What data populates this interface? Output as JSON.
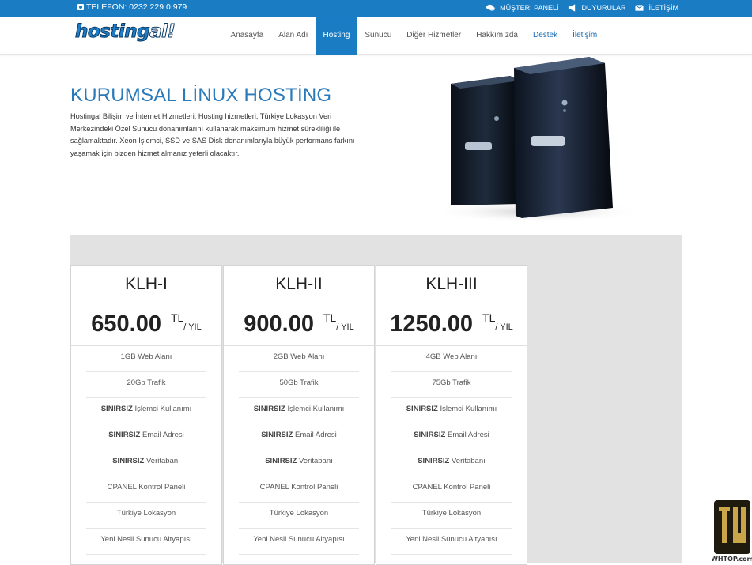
{
  "topbar": {
    "phone": "TELEFON: 0232 229 0 979",
    "links": [
      {
        "label": "MÜŞTERİ PANELİ",
        "icon": "chat-icon"
      },
      {
        "label": "DUYURULAR",
        "icon": "megaphone-icon"
      },
      {
        "label": "İLETİŞİM",
        "icon": "envelope-icon"
      }
    ]
  },
  "nav": {
    "logo_a": "hosting",
    "logo_b": "al!",
    "items": [
      {
        "label": "Anasayfa"
      },
      {
        "label": "Alan Adı"
      },
      {
        "label": "Hosting"
      },
      {
        "label": "Sunucu"
      },
      {
        "label": "Diğer Hizmetler"
      },
      {
        "label": "Hakkımızda"
      },
      {
        "label": "Destek"
      },
      {
        "label": "İletişim"
      }
    ]
  },
  "hero": {
    "title": "KURUMSAL LİNUX HOSTİNG",
    "text": "Hostingal Bilişim ve İnternet Hizmetleri, Hosting hizmetleri, Türkiye Lokasyon Veri Merkezindeki Özel Sunucu donanımlarını kullanarak maksimum hizmet sürekliliği ile sağlamaktadır. Xeon İşlemci, SSD ve SAS Disk donanımlarıyla büyük performans farkını yaşamak için bizden hizmet almanız yeterli olacaktır."
  },
  "plans": [
    {
      "name": "KLH-I",
      "price": "650.00",
      "currency": "TL",
      "period": "/ YIL",
      "features": [
        {
          "bold": "",
          "text": "1GB Web Alanı"
        },
        {
          "bold": "",
          "text": "20Gb Trafik"
        },
        {
          "bold": "SINIRSIZ",
          "text": " İşlemci Kullanımı"
        },
        {
          "bold": "SINIRSIZ",
          "text": " Email Adresi"
        },
        {
          "bold": "SINIRSIZ",
          "text": " Veritabanı"
        },
        {
          "bold": "",
          "text": "CPANEL Kontrol Paneli"
        },
        {
          "bold": "",
          "text": "Türkiye Lokasyon"
        },
        {
          "bold": "",
          "text": "Yeni Nesil Sunucu Altyapısı"
        }
      ]
    },
    {
      "name": "KLH-II",
      "price": "900.00",
      "currency": "TL",
      "period": "/ YIL",
      "features": [
        {
          "bold": "",
          "text": "2GB Web Alanı"
        },
        {
          "bold": "",
          "text": "50Gb Trafik"
        },
        {
          "bold": "SINIRSIZ",
          "text": " İşlemci Kullanımı"
        },
        {
          "bold": "SINIRSIZ",
          "text": " Email Adresi"
        },
        {
          "bold": "SINIRSIZ",
          "text": " Veritabanı"
        },
        {
          "bold": "",
          "text": "CPANEL Kontrol Paneli"
        },
        {
          "bold": "",
          "text": "Türkiye Lokasyon"
        },
        {
          "bold": "",
          "text": "Yeni Nesil Sunucu Altyapısı"
        }
      ]
    },
    {
      "name": "KLH-III",
      "price": "1250.00",
      "currency": "TL",
      "period": "/ YIL",
      "features": [
        {
          "bold": "",
          "text": "4GB Web Alanı"
        },
        {
          "bold": "",
          "text": "75Gb Trafik"
        },
        {
          "bold": "SINIRSIZ",
          "text": " İşlemci Kullanımı"
        },
        {
          "bold": "SINIRSIZ",
          "text": " Email Adresi"
        },
        {
          "bold": "SINIRSIZ",
          "text": " Veritabanı"
        },
        {
          "bold": "",
          "text": "CPANEL Kontrol Paneli"
        },
        {
          "bold": "",
          "text": "Türkiye Lokasyon"
        },
        {
          "bold": "",
          "text": "Yeni Nesil Sunucu Altyapısı"
        }
      ]
    }
  ],
  "watermark": {
    "text": "WHTOP.com"
  },
  "colors": {
    "brand": "#1a7dc4",
    "title": "#2a7ab9",
    "pricing_bg": "#e2e2e2"
  }
}
